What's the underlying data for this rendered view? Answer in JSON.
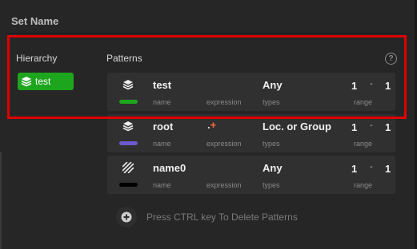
{
  "dialog": {
    "title": "Set Name"
  },
  "hierarchy": {
    "label": "Hierarchy",
    "items": [
      {
        "label": "test",
        "color": "#1ea51e",
        "icon": "layers-icon"
      }
    ]
  },
  "patterns": {
    "label": "Patterns",
    "help_icon": "?",
    "rows": [
      {
        "name": "test",
        "expression": "",
        "types": "Any",
        "range_min": "1",
        "range_sep": "-",
        "range_max": "1",
        "color": "#1ea51e",
        "icon": "layers-icon"
      },
      {
        "name": "root",
        "expression": ".+",
        "types": "Loc. or Group",
        "range_min": "1",
        "range_sep": "-",
        "range_max": "1",
        "color": "#6a5acd",
        "icon": "layers-icon"
      },
      {
        "name": "name0",
        "expression": "",
        "types": "Any",
        "range_min": "1",
        "range_sep": "-",
        "range_max": "1",
        "color": "#000000",
        "icon": "hatch-icon"
      }
    ],
    "sublabels": {
      "name": "name",
      "expression": "expression",
      "types": "types",
      "range": "range"
    }
  },
  "add_hint": "Press CTRL key To Delete Patterns",
  "highlight_color": "#e00000"
}
